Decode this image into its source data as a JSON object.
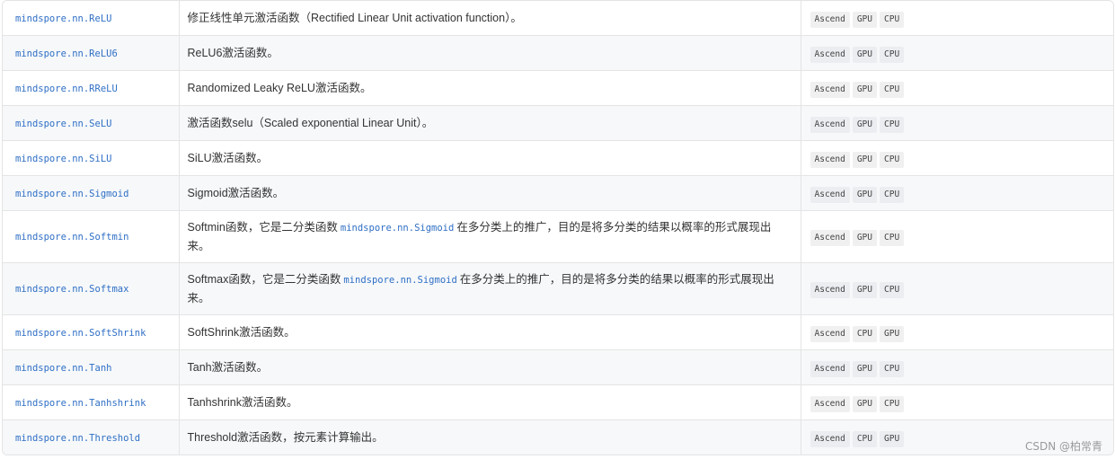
{
  "rows": [
    {
      "api": "mindspore.nn.ReLU",
      "desc": "修正线性单元激活函数（Rectified Linear Unit activation function）。",
      "platforms": [
        "Ascend",
        "GPU",
        "CPU"
      ]
    },
    {
      "api": "mindspore.nn.ReLU6",
      "desc": "ReLU6激活函数。",
      "platforms": [
        "Ascend",
        "GPU",
        "CPU"
      ]
    },
    {
      "api": "mindspore.nn.RReLU",
      "desc": "Randomized Leaky ReLU激活函数。",
      "platforms": [
        "Ascend",
        "GPU",
        "CPU"
      ]
    },
    {
      "api": "mindspore.nn.SeLU",
      "desc": "激活函数selu（Scaled exponential Linear Unit）。",
      "platforms": [
        "Ascend",
        "GPU",
        "CPU"
      ]
    },
    {
      "api": "mindspore.nn.SiLU",
      "desc": "SiLU激活函数。",
      "platforms": [
        "Ascend",
        "GPU",
        "CPU"
      ]
    },
    {
      "api": "mindspore.nn.Sigmoid",
      "desc": "Sigmoid激活函数。",
      "platforms": [
        "Ascend",
        "GPU",
        "CPU"
      ]
    },
    {
      "api": "mindspore.nn.Softmin",
      "desc_before": "Softmin函数，它是二分类函数",
      "desc_code": "mindspore.nn.Sigmoid",
      "desc_after": "在多分类上的推广，目的是将多分类的结果以概率的形式展现出来。",
      "platforms": [
        "Ascend",
        "GPU",
        "CPU"
      ]
    },
    {
      "api": "mindspore.nn.Softmax",
      "desc_before": "Softmax函数，它是二分类函数",
      "desc_code": "mindspore.nn.Sigmoid",
      "desc_after": "在多分类上的推广，目的是将多分类的结果以概率的形式展现出来。",
      "platforms": [
        "Ascend",
        "GPU",
        "CPU"
      ]
    },
    {
      "api": "mindspore.nn.SoftShrink",
      "desc": "SoftShrink激活函数。",
      "platforms": [
        "Ascend",
        "CPU",
        "GPU"
      ]
    },
    {
      "api": "mindspore.nn.Tanh",
      "desc": "Tanh激活函数。",
      "platforms": [
        "Ascend",
        "GPU",
        "CPU"
      ]
    },
    {
      "api": "mindspore.nn.Tanhshrink",
      "desc": "Tanhshrink激活函数。",
      "platforms": [
        "Ascend",
        "GPU",
        "CPU"
      ]
    },
    {
      "api": "mindspore.nn.Threshold",
      "desc": "Threshold激活函数，按元素计算输出。",
      "platforms": [
        "Ascend",
        "CPU",
        "GPU"
      ]
    }
  ],
  "watermark": "CSDN @柏常青"
}
